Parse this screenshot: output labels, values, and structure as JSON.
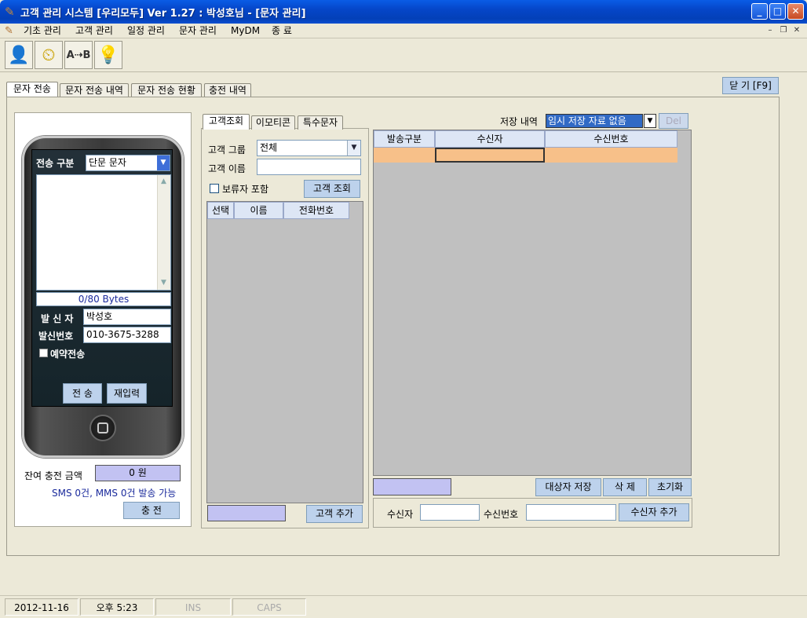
{
  "window": {
    "title": "고객 관리 시스템 [우리모두] Ver 1.27 : 박성호님 - [문자 관리]",
    "min": "_",
    "max": "□",
    "close": "✕"
  },
  "menu": {
    "items": [
      "기초 관리",
      "고객 관리",
      "일정 관리",
      "문자 관리",
      "MyDM",
      "종 료"
    ],
    "mdi_min": "–",
    "mdi_restore": "❐",
    "mdi_close": "✕"
  },
  "toolbar": {
    "icons": [
      "customer-icon",
      "clock-icon",
      "ab-transfer-icon",
      "lightbulb-icon"
    ],
    "glyphs": [
      "👤",
      "⏲",
      "A⇢B",
      "💡"
    ]
  },
  "tabs": [
    "문자 전송",
    "문자 전송 내역",
    "문자 전송 현황",
    "충전 내역"
  ],
  "close_button": "닫 기 [F9]",
  "phone": {
    "send_type_label": "전송 구분",
    "send_type_value": "단문 문자",
    "bytes": "0/80 Bytes",
    "sender_label": "발 신 자",
    "sender_value": "박성호",
    "number_label": "발신번호",
    "number_value": "010-3675-3288",
    "reserve_label": "예약전송",
    "send_button": "전 송",
    "reset_button": "재입력"
  },
  "balance": {
    "label": "잔여 충전 금액",
    "value": "0 원",
    "info": "SMS 0건, MMS 0건 발송 가능",
    "charge_button": "충 전"
  },
  "customer": {
    "tabs": [
      "고객조회",
      "이모티콘",
      "특수문자"
    ],
    "group_label": "고객 그룹",
    "group_value": "전체",
    "name_label": "고객 이름",
    "name_value": "",
    "include_label": "보류자 포함",
    "search_button": "고객 조회",
    "columns": [
      "선택",
      "이름",
      "전화번호"
    ],
    "add_button": "고객 추가"
  },
  "recipients": {
    "save_label": "저장 내역",
    "save_value": "임시 저장 자료 없음",
    "del_button": "Del",
    "columns": [
      "발송구분",
      "수신자",
      "수신번호"
    ],
    "save_target_button": "대상자 저장",
    "delete_button": "삭 제",
    "reset_button": "초기화",
    "recipient_label": "수신자",
    "number_label": "수신번호",
    "add_button": "수신자 추가"
  },
  "status": {
    "date": "2012-11-16",
    "time": "오후 5:23",
    "ins": "INS",
    "caps": "CAPS"
  }
}
